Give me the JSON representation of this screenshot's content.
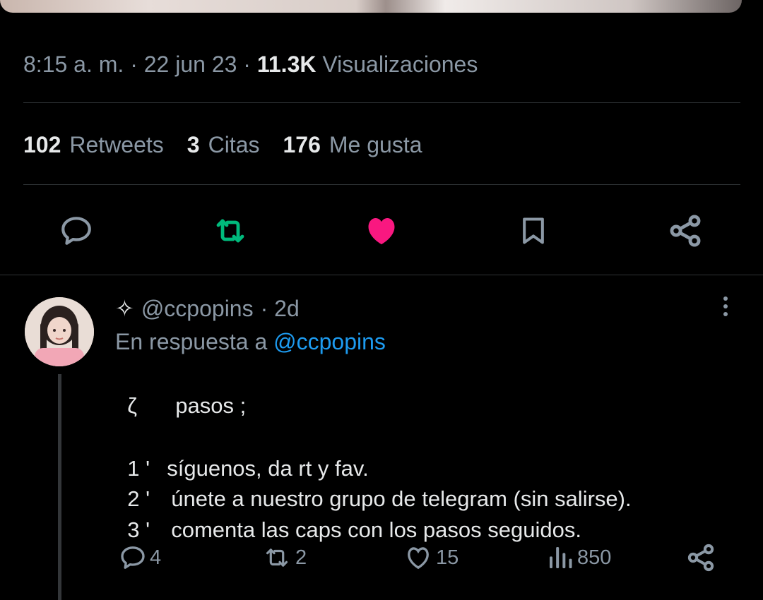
{
  "tweet": {
    "time": "8:15 a. m.",
    "sep": "·",
    "date": "22 jun 23",
    "views_count": "11.3K",
    "views_label": "Visualizaciones",
    "stats": [
      {
        "count": "102",
        "label": "Retweets"
      },
      {
        "count": "3",
        "label": "Citas"
      },
      {
        "count": "176",
        "label": "Me gusta"
      }
    ]
  },
  "colors": {
    "background": "#000000",
    "muted_text": "#8b98a5",
    "retweet_green": "#00ba7c",
    "like_pink": "#f91880",
    "link_blue": "#1d9bf0"
  },
  "icons": [
    "reply-icon",
    "retweet-icon",
    "like-filled-icon",
    "bookmark-icon",
    "share-icon",
    "sparkle-icon",
    "more-icon",
    "views-icon"
  ],
  "reply": {
    "sparkle": "✧",
    "handle": "@ccpopins",
    "age": "· 2d",
    "in_reply_prefix": "En respuesta a",
    "in_reply_handle": "@ccpopins",
    "lines": [
      {
        "mark": "ζ",
        "text": "pasos ;"
      },
      {
        "mark": "1 '",
        "text": "síguenos, da rt y fav."
      },
      {
        "mark": "2 '",
        "text": "únete a nuestro grupo de telegram (sin salirse)."
      },
      {
        "mark": "3 '",
        "text": "comenta las caps con los pasos seguidos."
      }
    ],
    "counts": {
      "replies": "4",
      "retweets": "2",
      "likes": "15",
      "views": "850"
    }
  }
}
